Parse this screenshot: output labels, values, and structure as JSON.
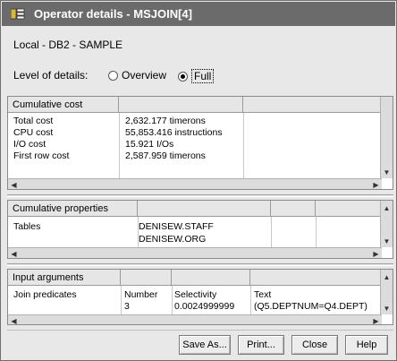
{
  "window": {
    "title": "Operator details - MSJOIN[4]"
  },
  "subtitle": "Local - DB2 - SAMPLE",
  "level": {
    "label": "Level of details:",
    "options": [
      {
        "label": "Overview",
        "selected": false
      },
      {
        "label": "Full",
        "selected": true
      }
    ]
  },
  "cumulative_cost": {
    "header": "Cumulative cost",
    "rows": [
      {
        "name": "Total cost",
        "value": "2,632.177 timerons"
      },
      {
        "name": "CPU cost",
        "value": "55,853.416 instructions"
      },
      {
        "name": "I/O cost",
        "value": "15.921 I/Os"
      },
      {
        "name": "First row cost",
        "value": "2,587.959 timerons"
      }
    ]
  },
  "cumulative_properties": {
    "header": "Cumulative properties",
    "rows": [
      {
        "name": "Tables",
        "values": [
          "DENISEW.STAFF",
          "DENISEW.ORG"
        ]
      }
    ]
  },
  "input_arguments": {
    "header": "Input arguments",
    "columns": [
      "",
      "Number",
      "Selectivity",
      "Text"
    ],
    "rows": [
      {
        "name": "Join predicates",
        "number_label": "Number",
        "number": "3",
        "selectivity_label": "Selectivity",
        "selectivity": "0.0024999999",
        "text_label": "Text",
        "text": "(Q5.DEPTNUM=Q4.DEPT)"
      }
    ]
  },
  "buttons": {
    "save_as": "Save As...",
    "print": "Print...",
    "close": "Close",
    "help": "Help"
  }
}
